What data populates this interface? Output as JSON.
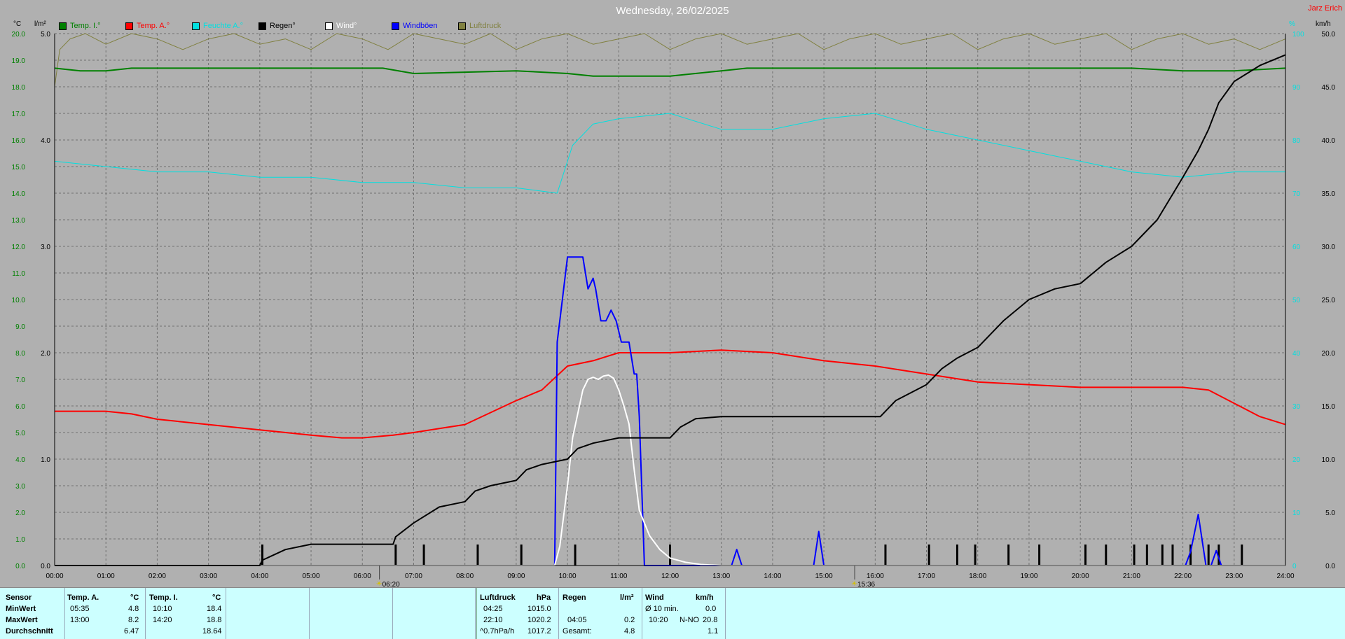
{
  "colors": {
    "temp_i": "#008000",
    "temp_a": "#ff0000",
    "humidity": "#00e0e0",
    "rain": "#000000",
    "wind": "#ffffff",
    "gusts": "#0000ff",
    "pressure": "#808040",
    "event_marker": "#d4c000"
  },
  "header": {
    "title": "Wednesday, 26/02/2025",
    "brand": "Jarz Erich",
    "unit_temp": "°C",
    "unit_rain": "l/m²",
    "unit_right_pct": "%",
    "unit_right_wind": "km/h",
    "sunrise": "06:20",
    "sunset": "15:36"
  },
  "legend": [
    {
      "key": "temp_i",
      "label": "Temp. I.°"
    },
    {
      "key": "temp_a",
      "label": "Temp. A.°"
    },
    {
      "key": "humidity",
      "label": "Feuchte A.°"
    },
    {
      "key": "rain",
      "label": "Regen°"
    },
    {
      "key": "wind",
      "label": "Wind°"
    },
    {
      "key": "gusts",
      "label": "Windböen"
    },
    {
      "key": "pressure",
      "label": "Luftdruck"
    }
  ],
  "chart_data": {
    "type": "line",
    "title": "Wednesday, 26/02/2025",
    "x_ticks": [
      "00:00",
      "01:00",
      "02:00",
      "03:00",
      "04:00",
      "05:00",
      "06:00",
      "07:00",
      "08:00",
      "09:00",
      "10:00",
      "11:00",
      "12:00",
      "13:00",
      "14:00",
      "15:00",
      "16:00",
      "17:00",
      "18:00",
      "19:00",
      "20:00",
      "21:00",
      "22:00",
      "23:00",
      "24:00"
    ],
    "xlim": [
      0,
      24
    ],
    "y_left_temp": {
      "unit": "°C",
      "lim": [
        0,
        20
      ],
      "ticks": [
        "0.0",
        "1.0",
        "2.0",
        "3.0",
        "4.0",
        "5.0",
        "6.0",
        "7.0",
        "8.0",
        "9.0",
        "10.0",
        "11.0",
        "12.0",
        "13.0",
        "14.0",
        "15.0",
        "16.0",
        "17.0",
        "18.0",
        "19.0",
        "20.0"
      ]
    },
    "y_left_rain": {
      "unit": "l/m²",
      "lim": [
        0,
        5
      ],
      "ticks": [
        "0.0",
        "1.0",
        "2.0",
        "3.0",
        "4.0",
        "5.0"
      ]
    },
    "y_right_pct": {
      "unit": "%",
      "lim": [
        0,
        100
      ],
      "ticks": [
        "0",
        "10",
        "20",
        "30",
        "40",
        "50",
        "60",
        "70",
        "80",
        "90",
        "100"
      ]
    },
    "y_right_wind": {
      "unit": "km/h",
      "lim": [
        0,
        50
      ],
      "ticks": [
        "0.0",
        "5.0",
        "10.0",
        "15.0",
        "20.0",
        "25.0",
        "30.0",
        "35.0",
        "40.0",
        "45.0",
        "50.0"
      ]
    },
    "grid": true,
    "series": [
      {
        "key": "temp_i",
        "name": "Temp. I.°",
        "axis": "temp",
        "x": [
          0,
          0.5,
          1,
          1.5,
          3,
          6.4,
          7,
          9,
          10,
          10.5,
          12,
          13,
          13.5,
          15,
          17,
          18,
          21,
          22,
          23,
          24
        ],
        "y": [
          18.7,
          18.6,
          18.6,
          18.7,
          18.7,
          18.7,
          18.5,
          18.6,
          18.5,
          18.4,
          18.4,
          18.6,
          18.7,
          18.7,
          18.7,
          18.7,
          18.7,
          18.6,
          18.6,
          18.7
        ]
      },
      {
        "key": "temp_a",
        "name": "Temp. A.°",
        "axis": "temp",
        "x": [
          0,
          1,
          1.5,
          2,
          3,
          4,
          5,
          5.6,
          6,
          6.6,
          7,
          8,
          9,
          9.5,
          10,
          10.5,
          11,
          12,
          13,
          14,
          15,
          16,
          17,
          18,
          19,
          20,
          21,
          22,
          22.5,
          23,
          23.5,
          24
        ],
        "y": [
          5.8,
          5.8,
          5.7,
          5.5,
          5.3,
          5.1,
          4.9,
          4.8,
          4.8,
          4.9,
          5.0,
          5.3,
          6.2,
          6.6,
          7.5,
          7.7,
          8.0,
          8.0,
          8.1,
          8.0,
          7.7,
          7.5,
          7.2,
          6.9,
          6.8,
          6.7,
          6.7,
          6.7,
          6.6,
          6.1,
          5.6,
          5.3
        ]
      },
      {
        "key": "humidity",
        "name": "Feuchte A.°",
        "axis": "pct",
        "x": [
          0,
          1,
          2,
          3,
          4,
          5,
          6,
          7,
          8,
          9,
          9.8,
          10.1,
          10.5,
          11,
          12,
          13,
          14,
          15,
          16,
          17,
          18,
          19,
          20,
          21,
          22,
          23,
          24
        ],
        "y": [
          76,
          75,
          74,
          74,
          73,
          73,
          72,
          72,
          71,
          71,
          70,
          79,
          83,
          84,
          85,
          82,
          82,
          84,
          85,
          82,
          80,
          78,
          76,
          74,
          73,
          74,
          74
        ]
      },
      {
        "key": "pressure",
        "name": "Luftdruck",
        "axis": "pct",
        "x": [
          0,
          0.1,
          0.3,
          0.6,
          1,
          1.5,
          2,
          2.5,
          3,
          3.5,
          4,
          4.5,
          5,
          5.5,
          6,
          6.5,
          7,
          7.5,
          8,
          8.5,
          9,
          9.5,
          10,
          10.5,
          11,
          11.5,
          12,
          12.5,
          13,
          13.5,
          14,
          14.5,
          15,
          15.5,
          16,
          16.5,
          17,
          17.5,
          18,
          18.5,
          19,
          19.5,
          20,
          20.5,
          21,
          21.5,
          22,
          22.5,
          23,
          23.5,
          24
        ],
        "y": [
          90,
          97,
          99,
          100,
          98,
          100,
          99,
          97,
          99,
          100,
          98,
          99,
          97,
          100,
          99,
          97,
          100,
          99,
          98,
          100,
          97,
          99,
          100,
          98,
          99,
          100,
          97,
          99,
          100,
          98,
          99,
          100,
          97,
          99,
          100,
          98,
          99,
          100,
          97,
          99,
          100,
          98,
          99,
          100,
          97,
          99,
          100,
          98,
          99,
          97,
          99
        ]
      },
      {
        "key": "rain",
        "name": "Regen°",
        "axis": "rain",
        "x": [
          0,
          4.0,
          4.05,
          4.5,
          5,
          6.6,
          6.65,
          7,
          7.5,
          8,
          8.2,
          8.5,
          9,
          9.2,
          9.5,
          10,
          10.2,
          10.5,
          11,
          11.5,
          12,
          12.2,
          12.5,
          13,
          15,
          16.1,
          16.4,
          17,
          17.3,
          17.6,
          18,
          18.5,
          19,
          19.5,
          20,
          20.5,
          21,
          21.5,
          22,
          22.3,
          22.5,
          22.7,
          23,
          23.5,
          24
        ],
        "y": [
          0,
          0,
          0.05,
          0.15,
          0.2,
          0.2,
          0.27,
          0.4,
          0.55,
          0.6,
          0.7,
          0.75,
          0.8,
          0.9,
          0.95,
          1.0,
          1.1,
          1.15,
          1.2,
          1.2,
          1.2,
          1.3,
          1.38,
          1.4,
          1.4,
          1.4,
          1.55,
          1.7,
          1.85,
          1.95,
          2.05,
          2.3,
          2.5,
          2.6,
          2.65,
          2.85,
          3.0,
          3.25,
          3.65,
          3.9,
          4.1,
          4.35,
          4.55,
          4.7,
          4.8
        ]
      },
      {
        "key": "gusts",
        "name": "Windböen",
        "axis": "wind",
        "x": [
          0,
          9.75,
          9.8,
          9.9,
          10.0,
          10.1,
          10.3,
          10.4,
          10.5,
          10.55,
          10.65,
          10.75,
          10.85,
          10.95,
          11.05,
          11.2,
          11.3,
          11.35,
          11.4,
          11.5,
          13.2,
          13.3,
          13.4,
          14.8,
          14.9,
          15.0,
          22.05,
          22.15,
          22.3,
          22.45,
          22.55,
          22.65,
          22.75,
          24
        ],
        "y": [
          0,
          0,
          21,
          25,
          29,
          29,
          29,
          26,
          27,
          26,
          23,
          23,
          24,
          23,
          21,
          21,
          18,
          18,
          14,
          0,
          0,
          1.5,
          0,
          0,
          3.2,
          0,
          0,
          1.3,
          4.8,
          0,
          0,
          1.4,
          0,
          0
        ]
      },
      {
        "key": "wind",
        "name": "Wind°",
        "axis": "wind",
        "x": [
          0,
          9.75,
          9.85,
          10.0,
          10.1,
          10.3,
          10.4,
          10.5,
          10.6,
          10.7,
          10.8,
          10.9,
          11.0,
          11.1,
          11.2,
          11.3,
          11.4,
          11.6,
          11.8,
          12.0,
          12.3,
          12.6,
          13.0,
          24
        ],
        "y": [
          0,
          0,
          1.8,
          7.5,
          12,
          16.5,
          17.5,
          17.7,
          17.5,
          17.8,
          17.9,
          17.6,
          16.5,
          15,
          13.3,
          9,
          5.2,
          2.8,
          1.5,
          0.7,
          0.3,
          0.1,
          0,
          0
        ]
      }
    ],
    "rain_events_x": [
      4.05,
      6.65,
      7.2,
      8.25,
      9.1,
      10.15,
      12.0,
      16.2,
      17.05,
      17.6,
      17.95,
      18.6,
      19.2,
      20.1,
      20.5,
      21.05,
      21.3,
      21.6,
      21.8,
      22.15,
      22.5,
      22.7,
      23.15
    ],
    "sunrise_hour": 6.333,
    "sunset_hour": 15.6
  },
  "summary": {
    "row_labels": [
      "Sensor",
      "MinWert",
      "MaxWert",
      "Durchschnitt"
    ],
    "temp_a": {
      "header": "Temp. A.",
      "unit": "°C",
      "min_time": "05:35",
      "min_value": "4.8",
      "max_time": "13:00",
      "max_value": "8.2",
      "avg": "6.47"
    },
    "temp_i": {
      "header": "Temp. I.",
      "unit": "°C",
      "min_time": "10:10",
      "min_value": "18.4",
      "max_time": "14:20",
      "max_value": "18.8",
      "avg": "18.64"
    },
    "pressure": {
      "header": "Luftdruck",
      "unit": "hPa",
      "min_time": "04:25",
      "min_value": "1015.0",
      "max_time": "22:10",
      "max_value": "1020.2",
      "trend_label": "^0.7hPa/h",
      "avg": "1017.2"
    },
    "rain": {
      "header": "Regen",
      "unit": "l/m²",
      "max_time": "04:05",
      "max_value": "0.2",
      "total_label": "Gesamt:",
      "total": "4.8"
    },
    "wind": {
      "header": "Wind",
      "unit": "km/h",
      "avg10_label": "Ø 10 min.",
      "avg10_value": "0.0",
      "max_time": "10:20",
      "max_dir": "N-NO",
      "max_value": "20.8",
      "avg": "1.1"
    }
  }
}
